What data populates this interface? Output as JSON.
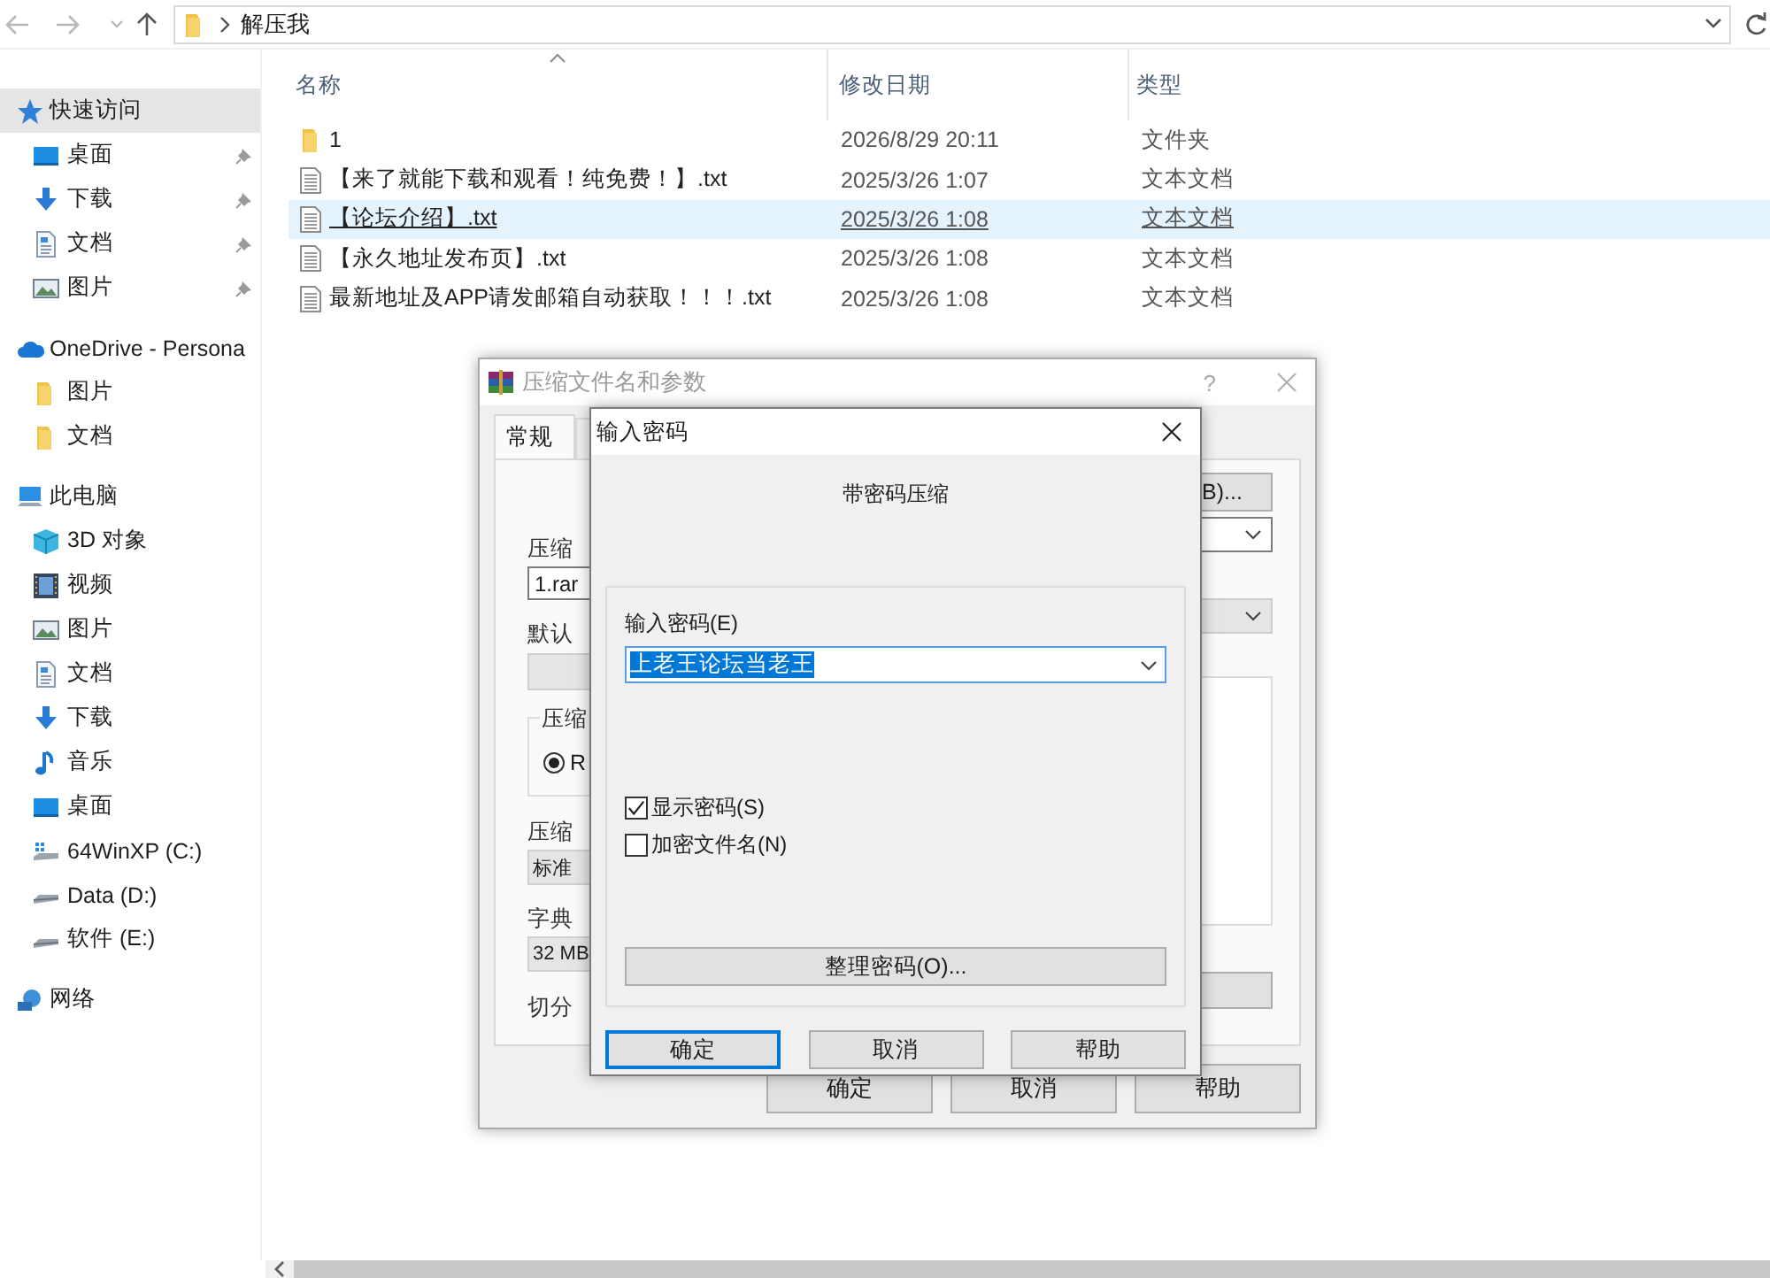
{
  "address_bar": {
    "path": "解压我"
  },
  "sidebar": {
    "items": [
      {
        "label": "快速访问",
        "kind": "star",
        "selected": true,
        "pinned": false,
        "children": [
          {
            "label": "桌面",
            "kind": "desktop",
            "selected": false,
            "pinned": true
          },
          {
            "label": "下载",
            "kind": "download",
            "selected": false,
            "pinned": true
          },
          {
            "label": "文档",
            "kind": "document",
            "selected": false,
            "pinned": true
          },
          {
            "label": "图片",
            "kind": "picture",
            "selected": false,
            "pinned": true
          }
        ]
      },
      {
        "label": "OneDrive - Persona",
        "kind": "cloud",
        "selected": false,
        "pinned": false,
        "children": [
          {
            "label": "图片",
            "kind": "folder",
            "selected": false,
            "pinned": false
          },
          {
            "label": "文档",
            "kind": "folder",
            "selected": false,
            "pinned": false
          }
        ]
      },
      {
        "label": "此电脑",
        "kind": "computer",
        "selected": false,
        "pinned": false,
        "children": [
          {
            "label": "3D 对象",
            "kind": "cube",
            "selected": false,
            "pinned": false
          },
          {
            "label": "视频",
            "kind": "film",
            "selected": false,
            "pinned": false
          },
          {
            "label": "图片",
            "kind": "picture",
            "selected": false,
            "pinned": false
          },
          {
            "label": "文档",
            "kind": "document",
            "selected": false,
            "pinned": false
          },
          {
            "label": "下载",
            "kind": "download",
            "selected": false,
            "pinned": false
          },
          {
            "label": "音乐",
            "kind": "music",
            "selected": false,
            "pinned": false
          },
          {
            "label": "桌面",
            "kind": "desktop",
            "selected": false,
            "pinned": false
          },
          {
            "label": "64WinXP  (C:)",
            "kind": "system-drive",
            "selected": false,
            "pinned": false
          },
          {
            "label": "Data (D:)",
            "kind": "drive",
            "selected": false,
            "pinned": false
          },
          {
            "label": "软件 (E:)",
            "kind": "drive",
            "selected": false,
            "pinned": false
          }
        ]
      },
      {
        "label": "网络",
        "kind": "network",
        "selected": false,
        "pinned": false
      }
    ]
  },
  "file_list": {
    "columns": [
      {
        "label": "名称",
        "sorted": true
      },
      {
        "label": "修改日期",
        "sorted": false
      },
      {
        "label": "类型",
        "sorted": false
      }
    ],
    "rows": [
      {
        "name": "1",
        "date": "2026/8/29 20:11",
        "type": "文件夹",
        "kind": "folder",
        "selected": false
      },
      {
        "name": "【来了就能下载和观看！纯免费！】.txt",
        "date": "2025/3/26 1:07",
        "type": "文本文档",
        "kind": "text",
        "selected": false
      },
      {
        "name": "【论坛介绍】.txt",
        "date": "2025/3/26 1:08",
        "type": "文本文档",
        "kind": "text",
        "selected": true
      },
      {
        "name": "【永久地址发布页】.txt",
        "date": "2025/3/26 1:08",
        "type": "文本文档",
        "kind": "text",
        "selected": false
      },
      {
        "name": "最新地址及APP请发邮箱自动获取！！！.txt",
        "date": "2025/3/26 1:08",
        "type": "文本文档",
        "kind": "text",
        "selected": false
      }
    ]
  },
  "archive_dialog": {
    "title": "压缩文件名和参数",
    "help_glyph": "?",
    "tabs": [
      {
        "label": "常规",
        "selected": true
      },
      {
        "selected": false
      }
    ],
    "labels": [
      "压缩",
      "默认",
      "压缩",
      "字典",
      "切分"
    ],
    "archive_name": "1.rar",
    "group_label": "压缩",
    "format_radio": {
      "label": "R",
      "selected": true
    },
    "method": "标准",
    "dictionary": "32 MB",
    "browse_button": "B)...",
    "buttons": [
      "确定",
      "取消",
      "帮助"
    ]
  },
  "password_dialog": {
    "title": "输入密码",
    "heading": "带密码压缩",
    "field_label": "输入密码(E)",
    "password": "上老王论坛当老王",
    "text_selected": true,
    "checkboxes": [
      {
        "label": "显示密码(S)",
        "checked": true
      },
      {
        "label": "加密文件名(N)",
        "checked": false
      }
    ],
    "organize_button": "整理密码(O)...",
    "buttons": [
      {
        "label": "确定",
        "default": true
      },
      {
        "label": "取消",
        "default": false
      },
      {
        "label": "帮助",
        "default": false
      }
    ]
  }
}
